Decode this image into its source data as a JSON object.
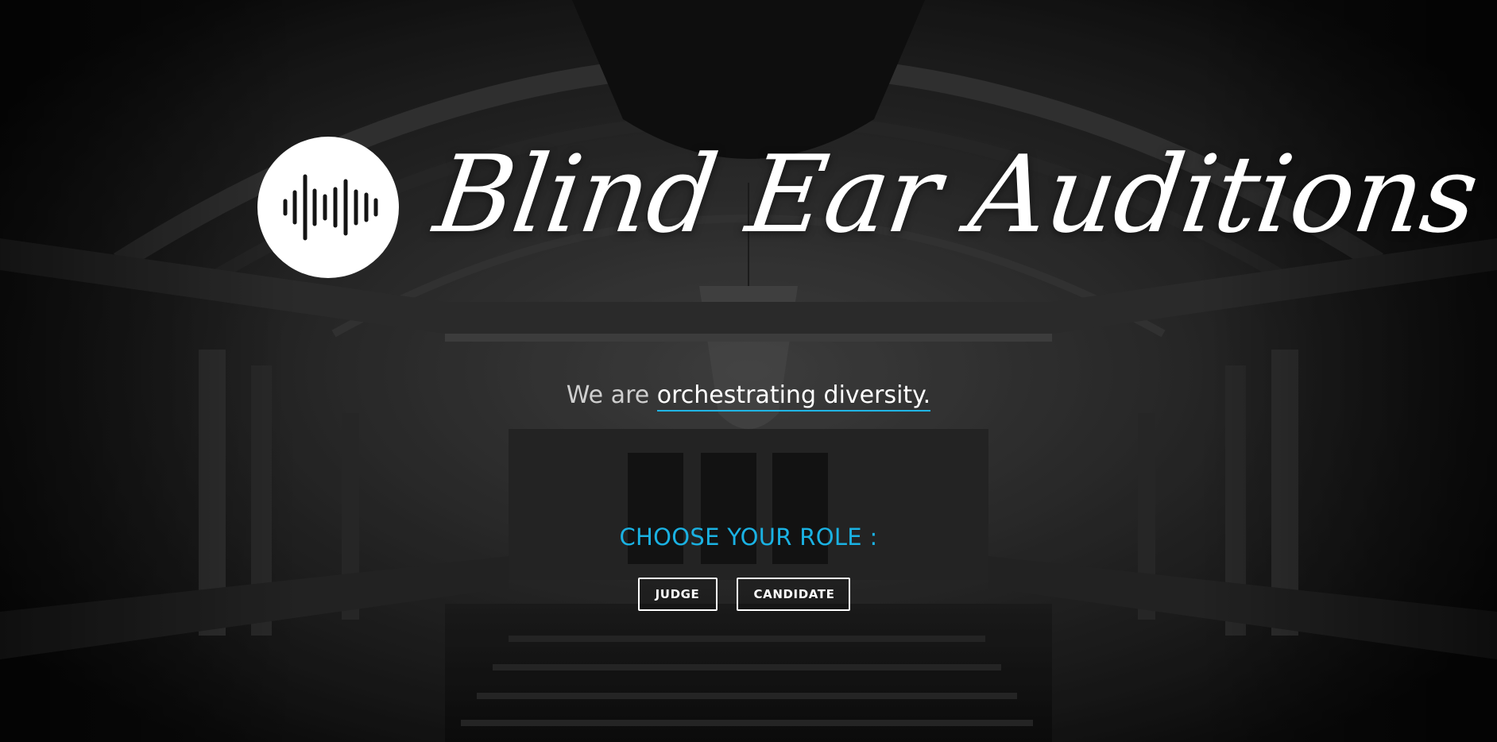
{
  "hero": {
    "logo_icon": "sound-wave-icon",
    "title": "Blind Ear Auditions",
    "tagline_lead": "We are ",
    "tagline_highlight": "orchestrating diversity."
  },
  "role_picker": {
    "heading": "CHOOSE YOUR ROLE :",
    "buttons": [
      {
        "label": "JUDGE"
      },
      {
        "label": "CANDIDATE"
      }
    ]
  },
  "colors": {
    "accent": "#1ab2e3",
    "underline": "#20b6e6",
    "text": "#ffffff",
    "overlay": "#141414"
  }
}
